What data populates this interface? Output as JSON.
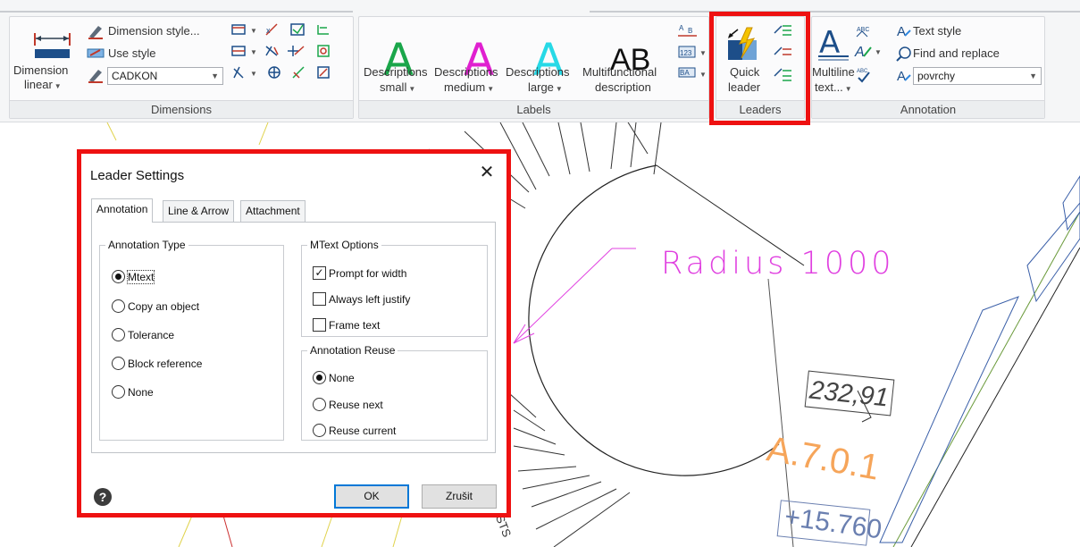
{
  "ribbon": {
    "dimensions": {
      "title": "Dimensions",
      "linear_label_1": "Dimension",
      "linear_label_2": "linear",
      "dimension_style": "Dimension style...",
      "use_style": "Use style",
      "style_value": "CADKON"
    },
    "labels": {
      "title": "Labels",
      "small_1": "Descriptions",
      "small_2": "small",
      "medium_1": "Descriptions",
      "medium_2": "medium",
      "large_1": "Descriptions",
      "large_2": "large",
      "multi_1": "Multifunctional",
      "multi_2": "description",
      "ab_glyph": "AB",
      "a_glyph": "A",
      "small_color": "#1aa64a",
      "medium_color": "#e020d0",
      "large_color": "#27d9e6"
    },
    "leaders": {
      "title": "Leaders",
      "quick_1": "Quick",
      "quick_2": "leader"
    },
    "annotation": {
      "title": "Annotation",
      "multiline_1": "Multiline",
      "multiline_2": "text...",
      "text_style": "Text style",
      "find_replace": "Find and replace",
      "style_value": "povrchy"
    }
  },
  "drawing": {
    "radius_text": "Radius 1000",
    "radius_color": "#e040e0",
    "elevation_1": "232,91",
    "point_label": "A.7.0.1",
    "point_color": "#f6a55a",
    "elevation_2": "+15.760",
    "rotated_text": "BSTS"
  },
  "dialog": {
    "title": "Leader Settings",
    "tabs": [
      "Annotation",
      "Line & Arrow",
      "Attachment"
    ],
    "annotation_type": {
      "legend": "Annotation Type",
      "options": [
        "Mtext",
        "Copy an object",
        "Tolerance",
        "Block reference",
        "None"
      ],
      "selected": "Mtext"
    },
    "mtext_options": {
      "legend": "MText Options",
      "options": [
        {
          "label": "Prompt for width",
          "checked": true
        },
        {
          "label": "Always left justify",
          "checked": false
        },
        {
          "label": "Frame text",
          "checked": false
        }
      ]
    },
    "annotation_reuse": {
      "legend": "Annotation Reuse",
      "options": [
        "None",
        "Reuse next",
        "Reuse current"
      ],
      "selected": "None"
    },
    "ok_label": "OK",
    "cancel_label": "Zrušit",
    "help_glyph": "?"
  },
  "highlight_color": "#ee1111"
}
